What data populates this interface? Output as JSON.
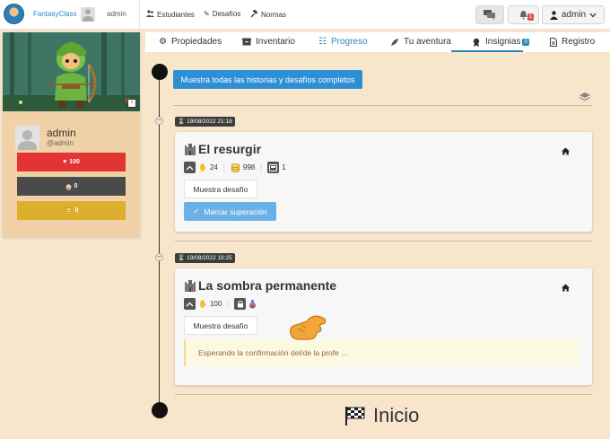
{
  "topbar": {
    "brand": "FantasyClass",
    "user_label": "admin",
    "nav": [
      {
        "label": "Estudiantes",
        "icon": "students-icon"
      },
      {
        "label": "Desafíos",
        "icon": "pencil-icon"
      },
      {
        "label": "Normas",
        "icon": "gavel-icon"
      }
    ],
    "notifications_count": "1",
    "account_label": "admin"
  },
  "sidebar": {
    "name": "admin",
    "handle": "@admin",
    "stats": [
      {
        "name": "health",
        "icon": "heart-icon",
        "value": "100",
        "color": "#e33434"
      },
      {
        "name": "experience",
        "icon": "owl-icon",
        "value": "0",
        "color": "#4a4a4a"
      },
      {
        "name": "gold",
        "icon": "coins-icon",
        "value": "0",
        "color": "#dcaf2c"
      }
    ]
  },
  "tabs": [
    {
      "label": "Propiedades",
      "icon": "gear-icon"
    },
    {
      "label": "Inventario",
      "icon": "box-icon"
    },
    {
      "label": "Progreso",
      "icon": "list-icon",
      "active": true
    },
    {
      "label": "Tu aventura",
      "icon": "feather-icon"
    },
    {
      "label": "Insignias",
      "icon": "medal-icon",
      "badge": "0"
    },
    {
      "label": "Registro",
      "icon": "file-icon"
    }
  ],
  "main": {
    "show_all_label": "Muestra todas las historias y desafíos completos",
    "entries": [
      {
        "date": "19/08/2022 21:18",
        "title": "El resurgir",
        "hp": "24",
        "gold": "998",
        "cards": "1",
        "button_label": "Muestra desafío",
        "mark_label": "Marcar superación"
      },
      {
        "date": "19/08/2022 19:25",
        "title": "La sombra permanente",
        "hp": "100",
        "button_label": "Muestra desafío",
        "waiting_text": "Esperando la confirmación del/de la profe ..."
      }
    ],
    "start_label": "Inicio"
  }
}
